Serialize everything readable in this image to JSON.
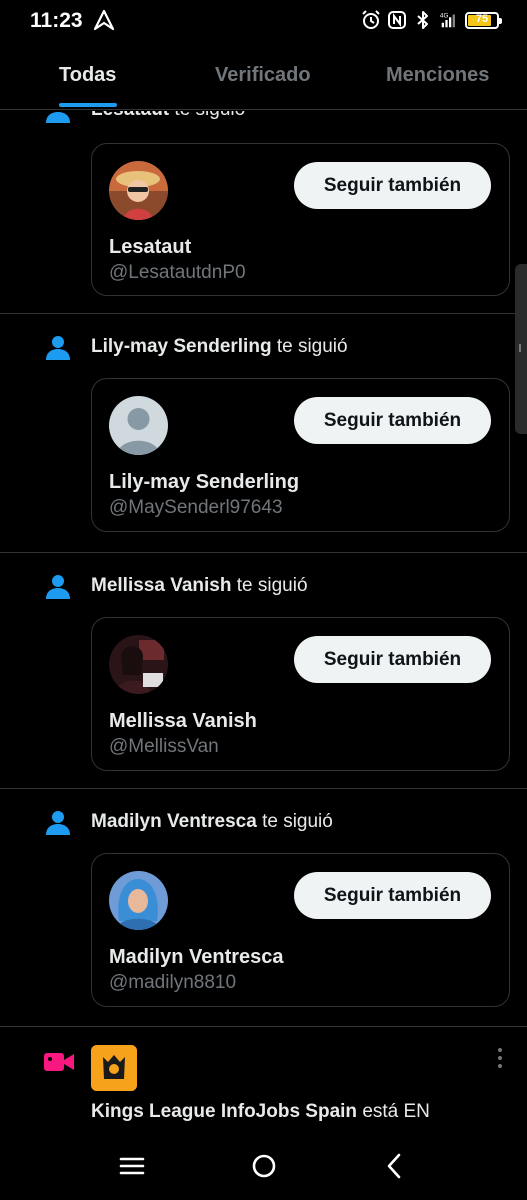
{
  "status_bar": {
    "time": "11:23",
    "network": "4G",
    "battery_level": "75",
    "icons": [
      "alarm-icon",
      "nfc-icon",
      "bluetooth-icon",
      "signal-icon",
      "battery-icon"
    ]
  },
  "tabs": [
    {
      "label": "Todas",
      "active": true
    },
    {
      "label": "Verificado",
      "active": false
    },
    {
      "label": "Menciones",
      "active": false
    }
  ],
  "notifications": [
    {
      "name": "Lesataut",
      "verb": "te siguió",
      "card_name": "Lesataut",
      "handle": "@LesatautdnP0",
      "button": "Seguir también"
    },
    {
      "name": "Lily-may Senderling",
      "verb": "te siguió",
      "card_name": "Lily-may Senderling",
      "handle": "@MaySenderl97643",
      "button": "Seguir también"
    },
    {
      "name": "Mellissa Vanish",
      "verb": "te siguió",
      "card_name": "Mellissa Vanish",
      "handle": "@MellissVan",
      "button": "Seguir también"
    },
    {
      "name": "Madilyn Ventresca",
      "verb": "te siguió",
      "card_name": "Madilyn Ventresca",
      "handle": "@madilyn8810",
      "button": "Seguir también"
    }
  ],
  "live": {
    "name": "Kings League InfoJobs Spain",
    "text": "está EN"
  },
  "colors": {
    "accent": "#1d9bf0",
    "live": "#f91880",
    "background": "#000000",
    "button_bg": "#eff3f4"
  }
}
